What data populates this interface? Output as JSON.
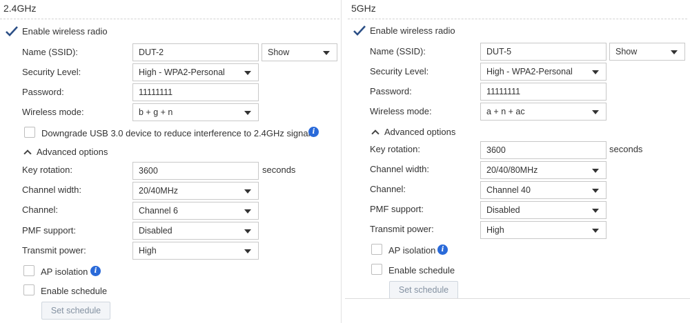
{
  "band_24": {
    "title": "2.4GHz",
    "enable_radio": {
      "label": "Enable wireless radio",
      "checked": true
    },
    "ssid": {
      "label": "Name (SSID):",
      "value": "DUT-2",
      "visibility": "Show"
    },
    "security": {
      "label": "Security Level:",
      "value": "High - WPA2-Personal"
    },
    "password": {
      "label": "Password:",
      "value": "11111111"
    },
    "wireless_mode": {
      "label": "Wireless mode:",
      "value": "b + g + n"
    },
    "downgrade_usb": {
      "label": "Downgrade USB 3.0 device to reduce interference to 2.4GHz signal",
      "checked": false
    },
    "advanced": {
      "label": "Advanced options"
    },
    "key_rotation": {
      "label": "Key rotation:",
      "value": "3600",
      "unit": "seconds"
    },
    "channel_width": {
      "label": "Channel width:",
      "value": "20/40MHz"
    },
    "channel": {
      "label": "Channel:",
      "value": "Channel 6"
    },
    "pmf": {
      "label": "PMF support:",
      "value": "Disabled"
    },
    "tx_power": {
      "label": "Transmit power:",
      "value": "High"
    },
    "ap_isolation": {
      "label": "AP isolation",
      "checked": false
    },
    "schedule": {
      "label": "Enable schedule",
      "checked": false
    },
    "set_schedule": {
      "label": "Set schedule"
    }
  },
  "band_5": {
    "title": "5GHz",
    "enable_radio": {
      "label": "Enable wireless radio",
      "checked": true
    },
    "ssid": {
      "label": "Name (SSID):",
      "value": "DUT-5",
      "visibility": "Show"
    },
    "security": {
      "label": "Security Level:",
      "value": "High - WPA2-Personal"
    },
    "password": {
      "label": "Password:",
      "value": "11111111"
    },
    "wireless_mode": {
      "label": "Wireless mode:",
      "value": "a + n + ac"
    },
    "advanced": {
      "label": "Advanced options"
    },
    "key_rotation": {
      "label": "Key rotation:",
      "value": "3600",
      "unit": "seconds"
    },
    "channel_width": {
      "label": "Channel width:",
      "value": "20/40/80MHz"
    },
    "channel": {
      "label": "Channel:",
      "value": "Channel 40"
    },
    "pmf": {
      "label": "PMF support:",
      "value": "Disabled"
    },
    "tx_power": {
      "label": "Transmit power:",
      "value": "High"
    },
    "ap_isolation": {
      "label": "AP isolation",
      "checked": false
    },
    "schedule": {
      "label": "Enable schedule",
      "checked": false
    },
    "set_schedule": {
      "label": "Set schedule"
    }
  },
  "colors": {
    "checkmark": "#2b4f86",
    "info_icon": "#2a6ad9",
    "disabled_button_text": "#8391a1"
  }
}
